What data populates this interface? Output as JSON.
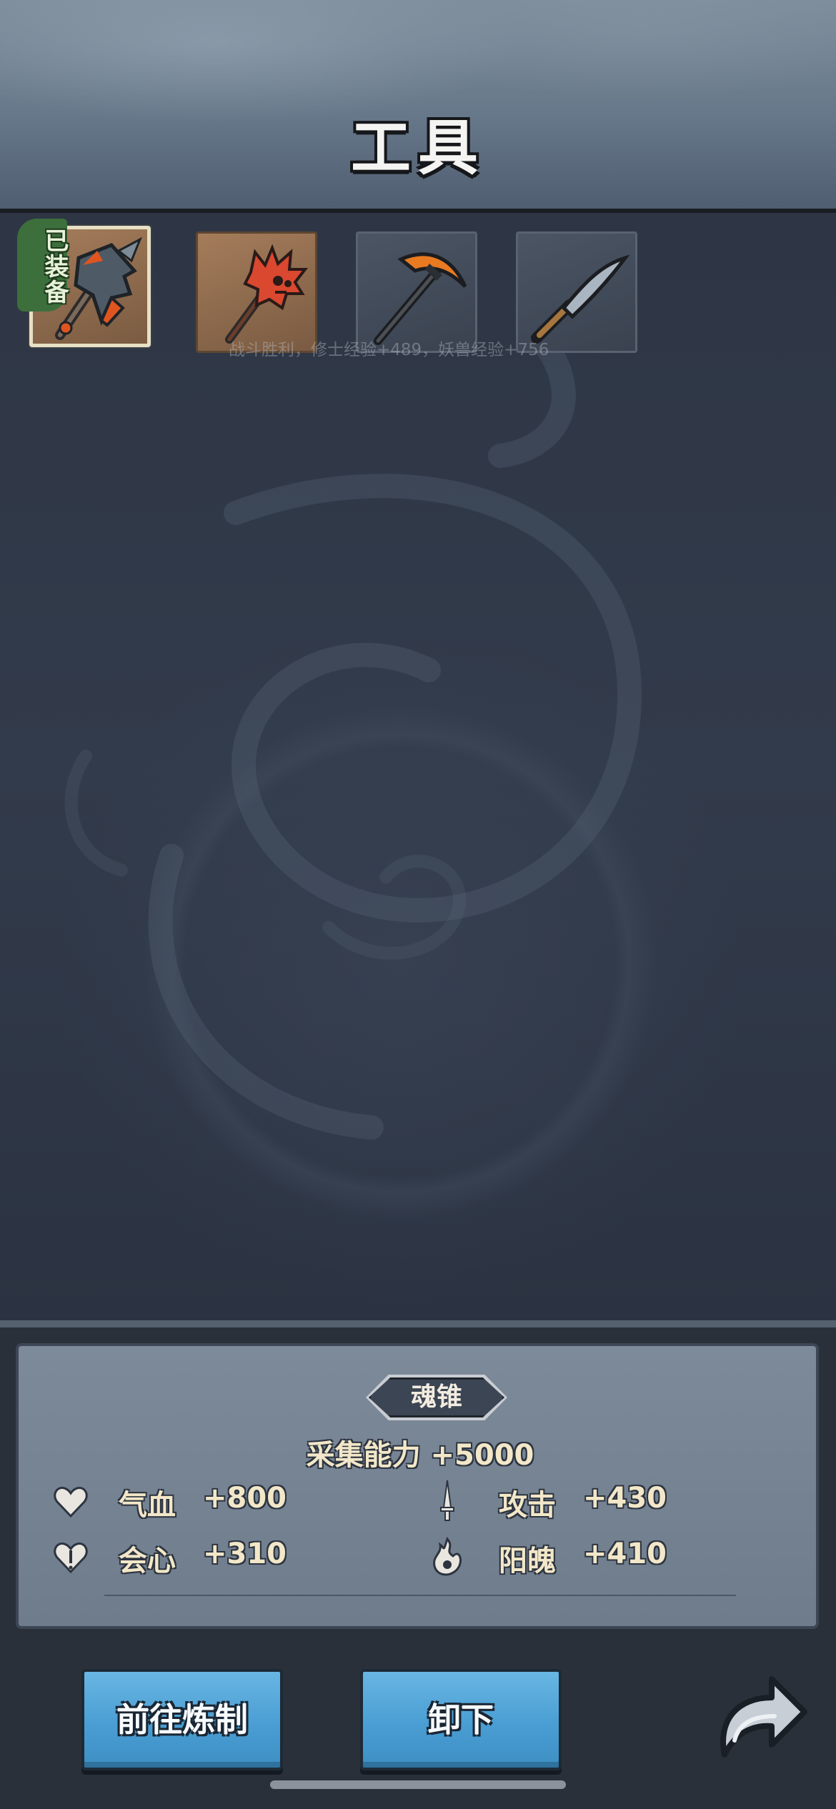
{
  "header": {
    "title": "工具"
  },
  "tools": {
    "equipped_badge": "已装备",
    "items": [
      {
        "icon": "spiked-axe-icon",
        "selected": true
      },
      {
        "icon": "skull-mace-icon",
        "selected": false
      },
      {
        "icon": "pickaxe-icon",
        "selected": false
      },
      {
        "icon": "sickle-icon",
        "selected": false
      }
    ],
    "toast": "战斗胜利，修士经验+489，妖兽经验+756"
  },
  "detail": {
    "name": "魂锥",
    "main_stat": "采集能力  +5000",
    "stats": [
      {
        "icon": "heart-icon",
        "label": "气血",
        "value": "+800"
      },
      {
        "icon": "sword-icon",
        "label": "攻击",
        "value": "+430"
      },
      {
        "icon": "crit-heart-icon",
        "label": "会心",
        "value": "+310"
      },
      {
        "icon": "soul-flame-icon",
        "label": "阳魄",
        "value": "+410"
      }
    ]
  },
  "actions": {
    "refine_label": "前往炼制",
    "unequip_label": "卸下",
    "back_icon": "return-arrow-icon"
  },
  "colors": {
    "button_blue": "#4a9ed3",
    "equipped_green": "#3c6f3b",
    "stat_text": "#f2e7c8"
  }
}
